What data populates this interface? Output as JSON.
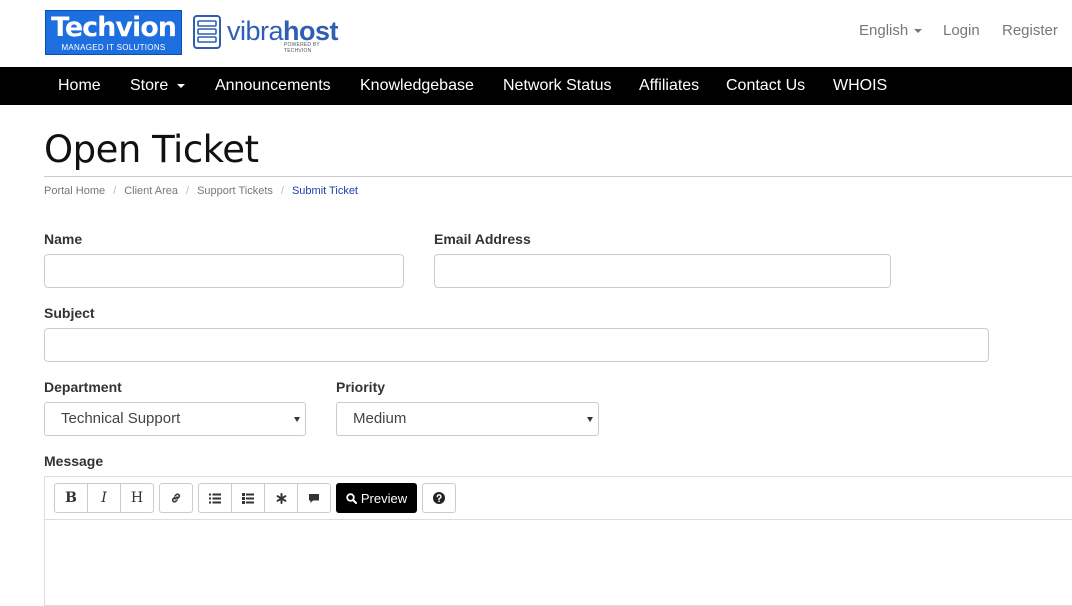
{
  "header": {
    "logo_primary": "Techvion",
    "logo_primary_tagline": "MANAGED IT SOLUTIONS",
    "logo_secondary_light": "vibra",
    "logo_secondary_bold": "host",
    "logo_secondary_tagline": "POWERED BY TECHVION",
    "language": "English",
    "login": "Login",
    "register": "Register"
  },
  "nav": {
    "home": "Home",
    "store": "Store",
    "announcements": "Announcements",
    "knowledgebase": "Knowledgebase",
    "network_status": "Network Status",
    "affiliates": "Affiliates",
    "contact_us": "Contact Us",
    "whois": "WHOIS"
  },
  "page": {
    "title": "Open Ticket",
    "breadcrumb": [
      "Portal Home",
      "Client Area",
      "Support Tickets",
      "Submit Ticket"
    ]
  },
  "form": {
    "name_label": "Name",
    "name_value": "",
    "email_label": "Email Address",
    "email_value": "",
    "subject_label": "Subject",
    "subject_value": "",
    "department_label": "Department",
    "department_value": "Technical Support",
    "priority_label": "Priority",
    "priority_value": "Medium",
    "message_label": "Message"
  },
  "editor_toolbar": {
    "bold": "B",
    "italic": "I",
    "heading": "H",
    "preview": "Preview",
    "icons": [
      "link-icon",
      "ordered-list-icon",
      "unordered-list-icon",
      "asterisk-icon",
      "comment-icon",
      "search-icon",
      "question-icon"
    ]
  },
  "colors": {
    "navbar": "#000000",
    "brand_blue": "#1d6fe0",
    "breadcrumb_active": "#1a3fb0"
  }
}
